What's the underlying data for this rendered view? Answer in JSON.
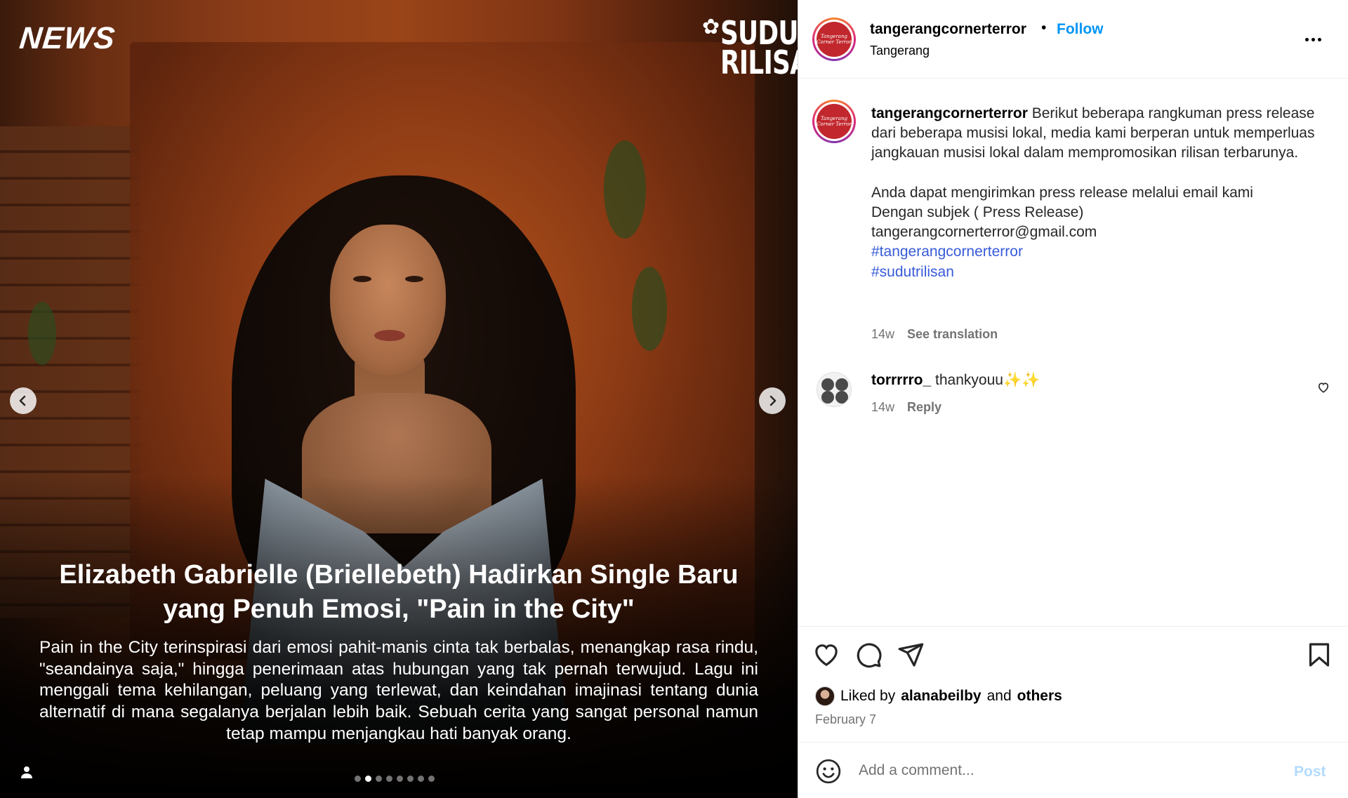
{
  "media": {
    "news_label": "NEWS",
    "brand_logo_lines": [
      "SUDUT",
      "RILISAN"
    ],
    "headline": "Elizabeth Gabrielle (Briellebeth) Hadirkan Single Baru yang Penuh Emosi, \"Pain in the City\"",
    "summary": "Pain in the City terinspirasi dari emosi pahit-manis cinta tak berbalas, menangkap rasa rindu, \"seandainya saja,\" hingga penerimaan atas hubungan yang tak pernah terwujud. Lagu ini menggali tema kehilangan, peluang yang terlewat, dan keindahan imajinasi tentang dunia alternatif di mana segalanya berjalan lebih baik. Sebuah cerita yang sangat personal namun tetap mampu menjangkau hati banyak orang.",
    "carousel": {
      "total": 8,
      "active_index": 1
    }
  },
  "header": {
    "username": "tangerangcornerterror",
    "separator": "•",
    "follow_label": "Follow",
    "location": "Tangerang",
    "avatar_text": "Tangerang Corner Terror"
  },
  "caption": {
    "username": "tangerangcornerterror",
    "text": " Berikut beberapa rangkuman press release dari beberapa musisi lokal, media kami berperan untuk memperluas jangkauan musisi lokal dalam mempromosikan rilisan terbarunya.\n\nAnda dapat mengirimkan press release melalui email kami\nDengan subjek ( Press Release)\ntangerangcornerterror@gmail.com\n",
    "hashtags": [
      "#tangerangcornerterror",
      "#sudutrilisan"
    ],
    "time": "14w",
    "translate_label": "See translation"
  },
  "comment": {
    "username": "torrrrro_",
    "text": " thankyouu✨✨",
    "time": "14w",
    "reply_label": "Reply"
  },
  "likes": {
    "prefix": "Liked by",
    "user": "alanabeilby",
    "joiner": "and",
    "others": "others",
    "date": "February 7"
  },
  "composer": {
    "placeholder": "Add a comment...",
    "post_label": "Post"
  },
  "colors": {
    "follow_blue": "#0095f6",
    "post_disabled": "#b3dbff",
    "hashtag": "#385bd8",
    "avatar_red": "#c1272d"
  }
}
